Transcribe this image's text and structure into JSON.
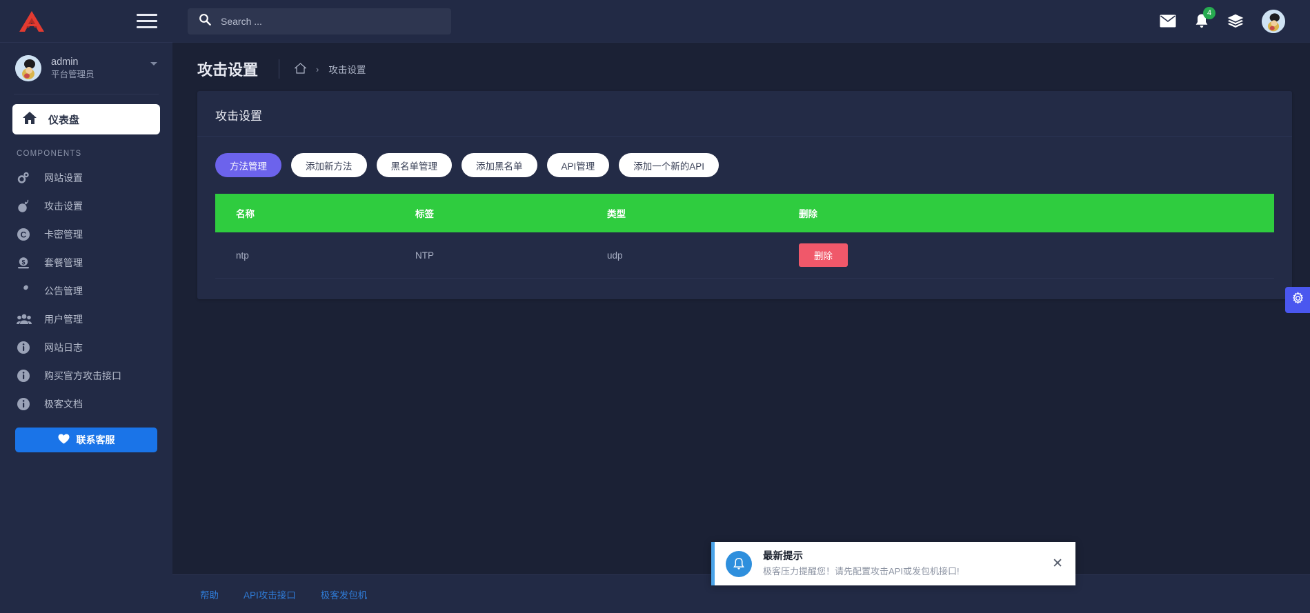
{
  "brand": {
    "logo_icon": "triangle-logo-icon",
    "menu_icon": "hamburger-menu-icon"
  },
  "profile": {
    "name": "admin",
    "role": "平台管理员",
    "avatar_icon": "user-avatar",
    "caret_icon": "chevron-down-icon"
  },
  "sidebar": {
    "dashboard": {
      "label": "仪表盘",
      "icon": "home-icon"
    },
    "section_label": "COMPONENTS",
    "items": [
      {
        "label": "网站设置",
        "icon": "gears-icon"
      },
      {
        "label": "攻击设置",
        "icon": "bomb-icon"
      },
      {
        "label": "卡密管理",
        "icon": "copyright-circle-icon"
      },
      {
        "label": "套餐管理",
        "icon": "money-icon"
      },
      {
        "label": "公告管理",
        "icon": "microphone-icon"
      },
      {
        "label": "用户管理",
        "icon": "users-icon"
      },
      {
        "label": "网站日志",
        "icon": "info-circle-icon"
      },
      {
        "label": "购买官方攻击接口",
        "icon": "info-circle-icon"
      },
      {
        "label": "极客文档",
        "icon": "info-circle-icon"
      }
    ],
    "support_button": {
      "label": "联系客服",
      "icon": "heart-icon",
      "color": "#1a74e8"
    }
  },
  "topbar": {
    "search": {
      "placeholder": "Search ...",
      "value": "",
      "icon": "search-icon"
    },
    "icons": [
      {
        "name": "envelope-icon",
        "badge": ""
      },
      {
        "name": "bell-icon",
        "badge": "4"
      },
      {
        "name": "layers-icon",
        "badge": ""
      }
    ],
    "avatar_icon": "user-avatar",
    "badge_color": "#27ab50"
  },
  "page": {
    "title": "攻击设置",
    "breadcrumb": {
      "home_icon": "home-outline-icon",
      "separator": "›",
      "current": "攻击设置"
    }
  },
  "card": {
    "title": "攻击设置",
    "tabs": [
      {
        "label": "方法管理",
        "active": true
      },
      {
        "label": "添加新方法",
        "active": false
      },
      {
        "label": "黑名单管理",
        "active": false
      },
      {
        "label": "添加黑名单",
        "active": false
      },
      {
        "label": "API管理",
        "active": false
      },
      {
        "label": "添加一个新的API",
        "active": false
      }
    ],
    "active_tab_color": "#6c63ec",
    "table": {
      "header_color": "#2fcc3f",
      "columns": [
        "名称",
        "标签",
        "类型",
        "删除"
      ],
      "rows": [
        {
          "name": "ntp",
          "tag": "NTP",
          "type": "udp",
          "action_label": "删除",
          "action_color": "#f0586a"
        }
      ]
    }
  },
  "gear_fab": {
    "icon": "gear-icon",
    "color": "#4a57ef"
  },
  "footer": {
    "links": [
      "帮助",
      "API攻击接口",
      "极客发包机"
    ],
    "link_color": "#2f7bd6"
  },
  "toast": {
    "icon": "bell-circle-icon",
    "title": "最新提示",
    "message": "极客压力提醒您！请先配置攻击API或发包机接口!",
    "close_icon": "close-icon",
    "accent_color": "#4aa3e8"
  }
}
